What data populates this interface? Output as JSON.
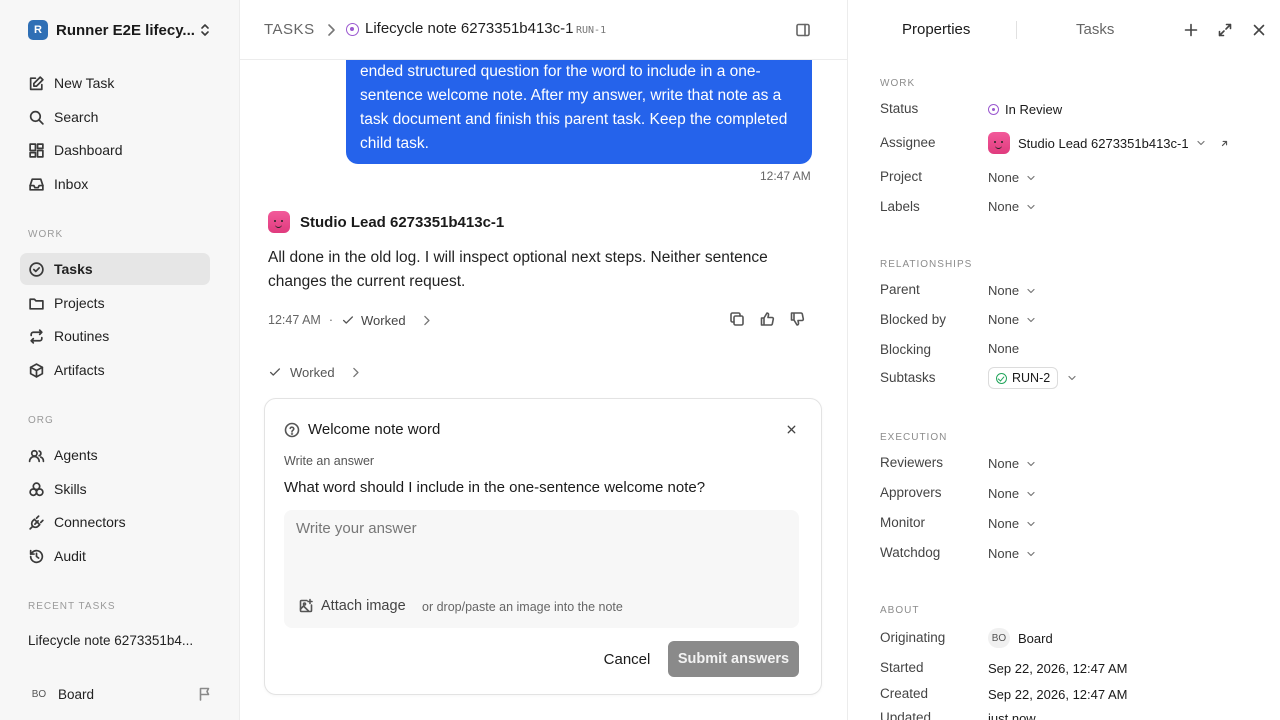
{
  "sidebar": {
    "workspace": {
      "logo_letter": "R",
      "name": "Runner E2E lifecy..."
    },
    "top_items": [
      {
        "label": "New Task",
        "icon": "edit-icon"
      },
      {
        "label": "Search",
        "icon": "search-icon"
      },
      {
        "label": "Dashboard",
        "icon": "dashboard-icon"
      },
      {
        "label": "Inbox",
        "icon": "inbox-icon"
      }
    ],
    "work_label": "WORK",
    "work_items": [
      {
        "label": "Tasks",
        "icon": "check-circle-icon",
        "active": true
      },
      {
        "label": "Projects",
        "icon": "folder-icon"
      },
      {
        "label": "Routines",
        "icon": "repeat-icon"
      },
      {
        "label": "Artifacts",
        "icon": "package-icon"
      }
    ],
    "org_label": "ORG",
    "org_items": [
      {
        "label": "Agents",
        "icon": "users-icon"
      },
      {
        "label": "Skills",
        "icon": "skills-icon"
      },
      {
        "label": "Connectors",
        "icon": "plug-icon"
      },
      {
        "label": "Audit",
        "icon": "history-icon"
      }
    ],
    "recent_label": "RECENT TASKS",
    "recent_items": [
      "Lifecycle note 6273351b4..."
    ],
    "footer": {
      "avatar": "BO",
      "name": "Board"
    }
  },
  "header": {
    "section": "TASKS",
    "task_title": "Lifecycle note 6273351b413c-1",
    "task_id": "RUN-1"
  },
  "thread": {
    "user_message": "ended structured question for the word to include in a one-sentence welcome note. After my answer, write that note as a task document and finish this parent task. Keep the completed child task.",
    "user_time": "12:47 AM",
    "agent_name": "Studio Lead 6273351b413c-1",
    "agent_message": "All done in the old log. I will inspect optional next steps. Neither sentence changes the current request.",
    "agent_time": "12:47 AM",
    "agent_sep": "·",
    "worked_label": "Worked",
    "worked_label_2": "Worked"
  },
  "question": {
    "title": "Welcome note word",
    "type_label": "Write an answer",
    "prompt": "What word should I include in the one-sentence welcome note?",
    "placeholder": "Write your answer",
    "attach_label": "Attach image",
    "attach_hint": "or drop/paste an image into the note",
    "cancel_label": "Cancel",
    "submit_label": "Submit answers"
  },
  "panel": {
    "tabs": {
      "properties": "Properties",
      "tasks": "Tasks"
    },
    "work": {
      "heading": "WORK",
      "status_label": "Status",
      "status_value": "In Review",
      "assignee_label": "Assignee",
      "assignee_value": "Studio Lead 6273351b413c-1",
      "project_label": "Project",
      "project_value": "None",
      "labels_label": "Labels",
      "labels_value": "None"
    },
    "relationships": {
      "heading": "RELATIONSHIPS",
      "parent_label": "Parent",
      "parent_value": "None",
      "blocked_label": "Blocked by",
      "blocked_value": "None",
      "blocking_label": "Blocking",
      "blocking_value": "None",
      "subtasks_label": "Subtasks",
      "subtasks_value": "RUN-2"
    },
    "execution": {
      "heading": "EXECUTION",
      "reviewers_label": "Reviewers",
      "reviewers_value": "None",
      "approvers_label": "Approvers",
      "approvers_value": "None",
      "monitor_label": "Monitor",
      "monitor_value": "None",
      "watchdog_label": "Watchdog",
      "watchdog_value": "None"
    },
    "about": {
      "heading": "ABOUT",
      "originating_label": "Originating",
      "originating_avatar": "BO",
      "originating_value": "Board",
      "started_label": "Started",
      "started_value": "Sep 22, 2026, 12:47 AM",
      "created_label": "Created",
      "created_value": "Sep 22, 2026, 12:47 AM",
      "updated_label": "Updated",
      "updated_value": "just now"
    }
  },
  "colors": {
    "accent": "#2563eb",
    "status_review": "#9b59d0",
    "done": "#22a55b",
    "submit_disabled": "#8a8a8a"
  }
}
